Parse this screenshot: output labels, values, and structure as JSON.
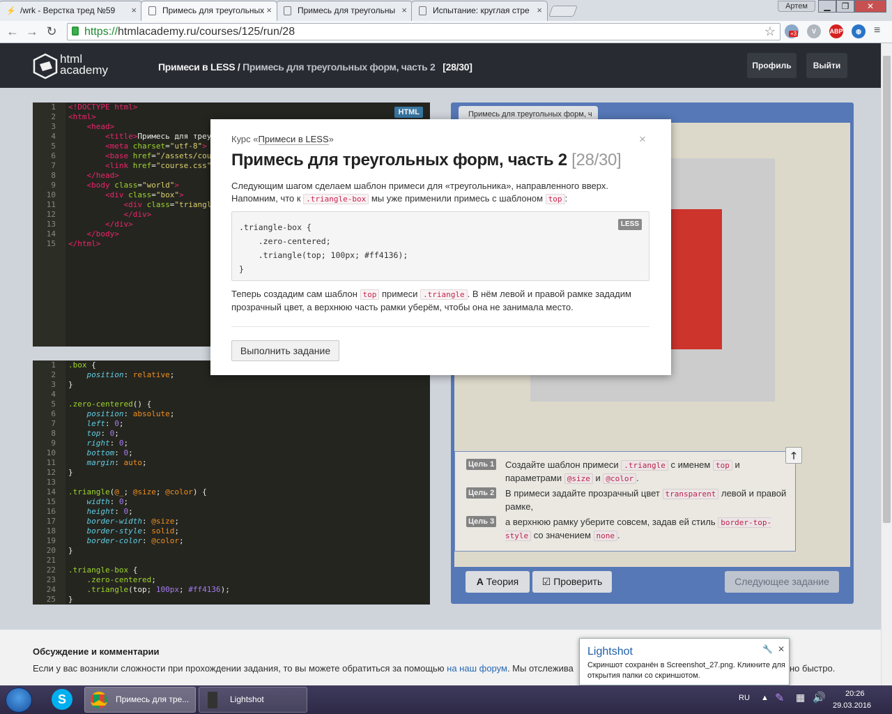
{
  "browser": {
    "tabs": [
      {
        "title": "/wrk - Верстка тред №59",
        "active": false
      },
      {
        "title": "Примесь для треугольных",
        "active": true
      },
      {
        "title": "Примесь для треугольны",
        "active": false
      },
      {
        "title": "Испытание: круглая стре",
        "active": false
      }
    ],
    "user_label": "Артем",
    "url_protocol": "https://",
    "url_rest": "htmlacademy.ru/courses/125/run/28",
    "ext_badge": "+3",
    "abp_label": "ABP"
  },
  "site": {
    "logo_line1": "html",
    "logo_line2": "academy",
    "crumb_course": "Примеси в LESS",
    "crumb_sep": " / ",
    "crumb_task": "Примесь для треугольных форм, часть 2",
    "crumb_count": "[28/30]",
    "profile_label": "Профиль",
    "logout_label": "Выйти"
  },
  "html_editor": {
    "lang": "HTML",
    "line_count": 15
  },
  "less_editor": {
    "line_count": 25
  },
  "preview": {
    "tab_title": "Примесь для треугольных форм, ч",
    "goals": [
      {
        "badge": "Цель 1",
        "t1": "Создайте шаблон примеси ",
        "c1": ".triangle",
        "t2": " с именем ",
        "c2": "top",
        "t3": " и параметрами ",
        "c3": "@size",
        "t4": " и ",
        "c4": "@color",
        "t5": "."
      },
      {
        "badge": "Цель 2",
        "t1": "В примеси задайте прозрачный цвет ",
        "c1": "transparent",
        "t2": " левой и правой рамке,"
      },
      {
        "badge": "Цель 3",
        "t1": "а верхнюю рамку уберите совсем, задав ей стиль ",
        "c1": "border-top-style",
        "t2": " со значением ",
        "c2": "none",
        "t3": "."
      }
    ],
    "up_arrow": "🡑",
    "theory_label": "Теория",
    "check_label": "Проверить",
    "next_label": "Следующее задание"
  },
  "discussion": {
    "title": "Обсуждение и комментарии",
    "text_before": "Если у вас возникли сложности при прохождении задания, то вы можете обратиться за помощью ",
    "link": "на наш форум",
    "text_after": ". Мы отслежива",
    "text_tail": "но быстро."
  },
  "modal": {
    "course_prefix": "Курс «",
    "course_name": "Примеси в LESS",
    "course_suffix": "»",
    "close": "×",
    "title": "Примесь для треугольных форм, часть 2",
    "title_count": "[28/30]",
    "p1_a": "Следующим шагом сделаем шаблон примеси для «треугольника», направленного вверх. Напомним, что к ",
    "p1_code1": ".triangle-box",
    "p1_b": " мы уже применили примесь с шаблоном ",
    "p1_code2": "top",
    "p1_c": ":",
    "code_lang": "LESS",
    "code": ".triangle-box {\n    .zero-centered;\n    .triangle(top; 100px; #ff4136);\n}",
    "p2_a": "Теперь создадим сам шаблон ",
    "p2_code1": "top",
    "p2_b": " примеси ",
    "p2_code2": ".triangle",
    "p2_c": ". В нём левой и правой рамке зададим прозрачный цвет, а верхнюю часть рамки уберём, чтобы она не занимала место.",
    "button": "Выполнить задание"
  },
  "toast": {
    "title": "Lightshot",
    "text": "Скриншот сохранён в Screenshot_27.png. Кликните для открытия папки со скриншотом."
  },
  "taskbar": {
    "items": [
      {
        "label": "Примесь для тре..."
      },
      {
        "label": "Lightshot"
      }
    ],
    "lang": "RU",
    "time": "20:26",
    "date": "29.03.2016"
  }
}
